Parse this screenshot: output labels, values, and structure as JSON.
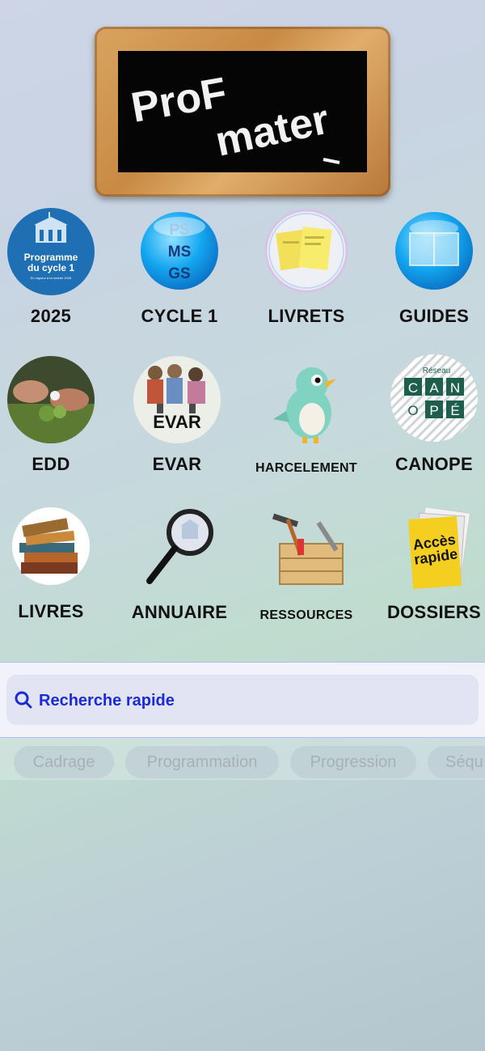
{
  "logo": {
    "line1": "ProF",
    "line2": "mater"
  },
  "tiles": [
    {
      "label": "2025",
      "icon_text": {
        "line1": "Programme",
        "line2": "du cycle 1",
        "line3": "En vigueur à la rentrée 2025"
      }
    },
    {
      "label": "CYCLE 1",
      "icon_text": {
        "line1": "PS",
        "line2": "MS",
        "line3": "GS"
      }
    },
    {
      "label": "LIVRETS"
    },
    {
      "label": "GUIDES"
    },
    {
      "label": "EDD"
    },
    {
      "label": "EVAR",
      "icon_text": {
        "line1": "EVAR"
      }
    },
    {
      "label": "HARCELEMENT"
    },
    {
      "label": "CANOPE",
      "icon_text": {
        "top": "Réseau",
        "r1": [
          "C",
          "A",
          "N"
        ],
        "r2": [
          "O",
          "P",
          "É"
        ]
      }
    },
    {
      "label": "LIVRES"
    },
    {
      "label": "ANNUAIRE"
    },
    {
      "label": "RESSOURCES"
    },
    {
      "label": "DOSSIERS",
      "icon_text": {
        "line1": "Accès",
        "line2": "rapide"
      }
    }
  ],
  "search": {
    "label": "Recherche rapide",
    "icon": "search-icon"
  },
  "chips": [
    "Cadrage",
    "Programmation",
    "Progression",
    "Séqu"
  ],
  "colors": {
    "accent": "#1a2bd8",
    "badge_blue": "#1f6fb5",
    "cyan": "#14a6f0"
  }
}
